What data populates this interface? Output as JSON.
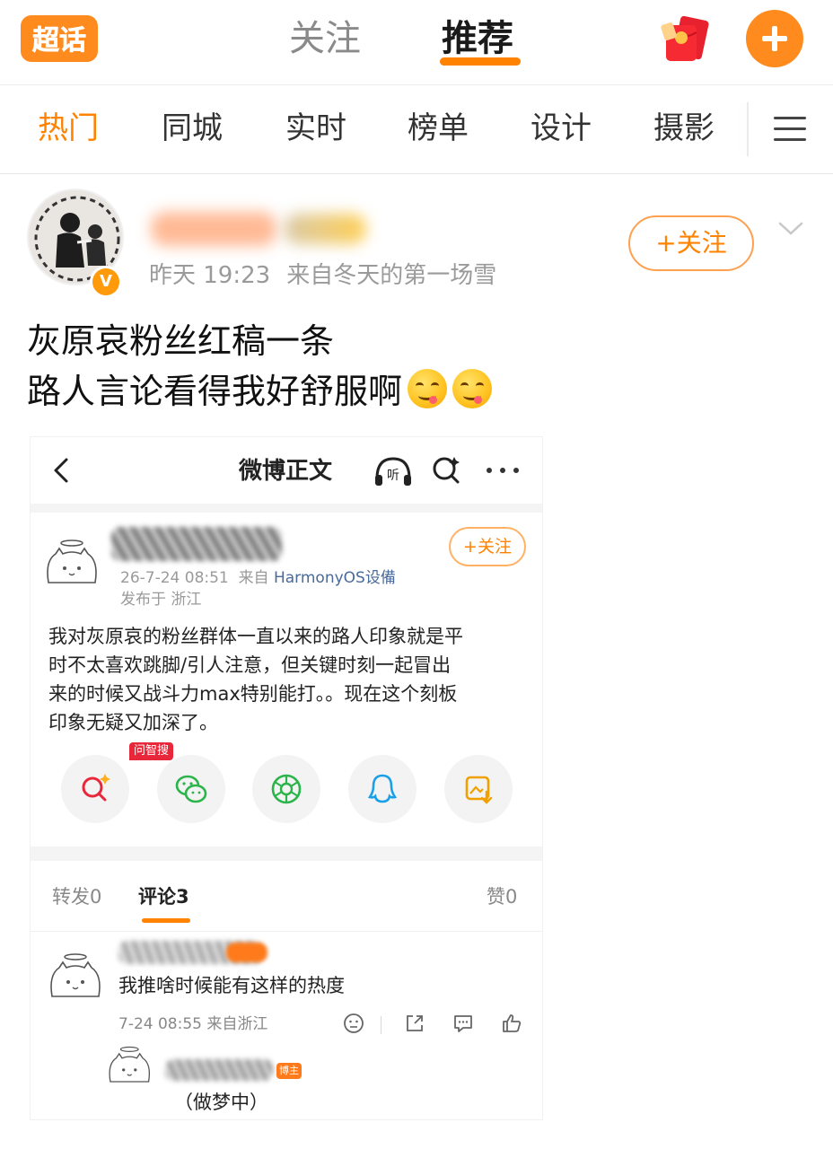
{
  "header": {
    "logo_text": "超话",
    "tabs": [
      {
        "label": "关注",
        "active": false
      },
      {
        "label": "推荐",
        "active": true
      }
    ],
    "accent_color": "#ff8200"
  },
  "categories": {
    "items": [
      "热门",
      "同城",
      "实时",
      "榜单",
      "设计",
      "摄影"
    ],
    "active_index": 0,
    "menu_icon": "hamburger-menu-icon"
  },
  "post": {
    "time": "昨天 19:23",
    "source": "来自冬天的第一场雪",
    "verified_badge": "V",
    "follow_label": "+关注",
    "lines": [
      "灰原哀粉丝红稿一条",
      "路人言论看得我好舒服啊"
    ],
    "emoji_icon": "yummy-face-emoji"
  },
  "screenshot": {
    "title": "微博正文",
    "listen_label": "听",
    "card": {
      "follow_label": "+关注",
      "time": "26-7-24 08:51",
      "source_prefix": "来自",
      "source": "HarmonyOS设備",
      "location": "发布于 浙江",
      "body_lines": [
        "我对灰原哀的粉丝群体一直以来的路人印象就是平",
        "时不太喜欢跳脚/引人注意，但关键时刻一起冒出",
        "来的时候又战斗力max特别能打。。现在这个刻板",
        "印象无疑又加深了。"
      ],
      "ask_badge": "问智搜",
      "share_icons": [
        "ai-search-icon",
        "wechat-icon",
        "moments-icon",
        "qq-icon",
        "save-image-icon"
      ]
    },
    "tabs": {
      "repost": "转发0",
      "comments": "评论3",
      "likes": "赞0"
    },
    "comments": [
      {
        "text": "我推啥时候能有这样的热度",
        "time": "7-24 08:55",
        "location": "来自浙江"
      },
      {
        "text": "（做梦中）",
        "badge": "博主"
      }
    ]
  }
}
